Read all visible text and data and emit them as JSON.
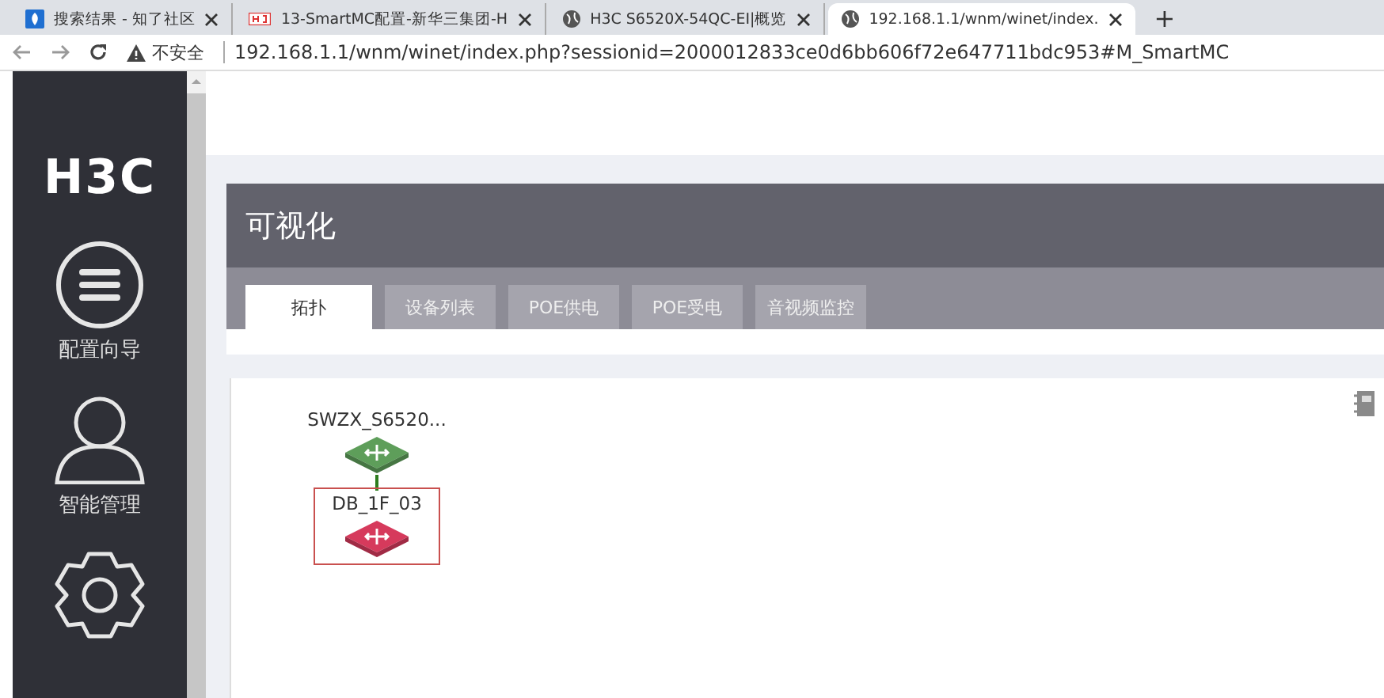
{
  "browser_tabs": [
    {
      "title": "搜索结果 - 知了社区",
      "kind": "doc",
      "selected": false
    },
    {
      "title": "13-SmartMC配置-新华三集团-H",
      "kind": "brand",
      "selected": false
    },
    {
      "title": "H3C S6520X-54QC-EI|概览",
      "kind": "globe",
      "selected": false
    },
    {
      "title": "192.168.1.1/wnm/winet/index.",
      "kind": "globe",
      "selected": true
    }
  ],
  "new_tab": "+",
  "address_bar": {
    "security": "不安全",
    "url": "192.168.1.1/wnm/winet/index.php?sessionid=2000012833ce0d6bb606f72e647711bdc953#M_SmartMC"
  },
  "logo": "H3C",
  "sidebar": {
    "items": [
      {
        "label": "配置向导",
        "kind": "guide"
      },
      {
        "label": "智能管理",
        "kind": "user"
      },
      {
        "kind": "settings"
      }
    ]
  },
  "panel": {
    "title": "可视化",
    "tabs": [
      {
        "label": "拓扑",
        "selected": true
      },
      {
        "label": "设备列表",
        "selected": false
      },
      {
        "label": "POE供电",
        "selected": false
      },
      {
        "label": "POE受电",
        "selected": false
      },
      {
        "label": "音视频监控",
        "selected": false
      }
    ]
  },
  "topology": {
    "nodes": [
      {
        "name": "SWZX_S6520...",
        "color": "#5e9e5a",
        "selected": false
      },
      {
        "name": "DB_1F_03",
        "color": "#d63a5c",
        "selected": true
      }
    ]
  }
}
